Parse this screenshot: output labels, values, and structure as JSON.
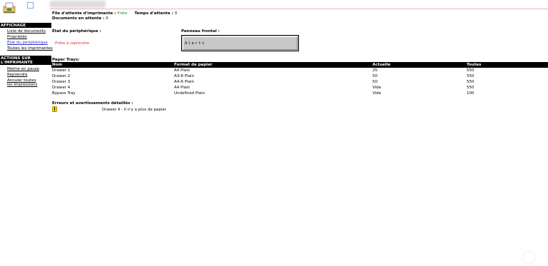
{
  "header": {
    "queue_label": "File d'attente d'imprimante :",
    "queue_value": "Prête",
    "wait_label": "Temps d'attente :",
    "wait_value": "0",
    "docs_label": "Documents en attente :",
    "docs_value": "0"
  },
  "sidebar": {
    "display_section": "AFFICHAGE",
    "display_items": [
      {
        "label": "Liste de documents"
      },
      {
        "label": "Propriétés"
      },
      {
        "label": "État du périphérique"
      },
      {
        "label": "Toutes les imprimantes"
      }
    ],
    "actions_section": "ACTIONS SUR L'IMPRIMANTE",
    "action_items": [
      {
        "label": "Mettre en pause"
      },
      {
        "label": "Reprendre"
      },
      {
        "label": "Annuler toutes les impressions"
      }
    ]
  },
  "device": {
    "status_label": "État du périphérique :",
    "status_value": "Prête à reprendre",
    "panel_label": "Panneau frontal :",
    "panel_text": "Alerts"
  },
  "trays": {
    "title": "Paper Trays:",
    "columns": [
      "Nom",
      "Format de papier",
      "Actuelle",
      "Toutes"
    ],
    "rows": [
      [
        "Drawer 1",
        "A4 Plain",
        "25",
        "550"
      ],
      [
        "Drawer 2",
        "A3-R Plain",
        "50",
        "550"
      ],
      [
        "Drawer 3",
        "A4-R Plain",
        "50",
        "550"
      ],
      [
        "Drawer 4",
        "A4 Plain",
        "Vide",
        "550"
      ],
      [
        "Bypass Tray",
        "Undefined Plain",
        "Vide",
        "100"
      ]
    ]
  },
  "errors": {
    "title": "Erreurs et avertissements détaillés :",
    "icon": "warning-icon",
    "message": "Drawer 4 - Il n'y a plus de papier"
  },
  "colors": {
    "status_ok": "#2d8a2d",
    "status_warn": "#e03131",
    "header_rule": "#f3b3bf"
  }
}
